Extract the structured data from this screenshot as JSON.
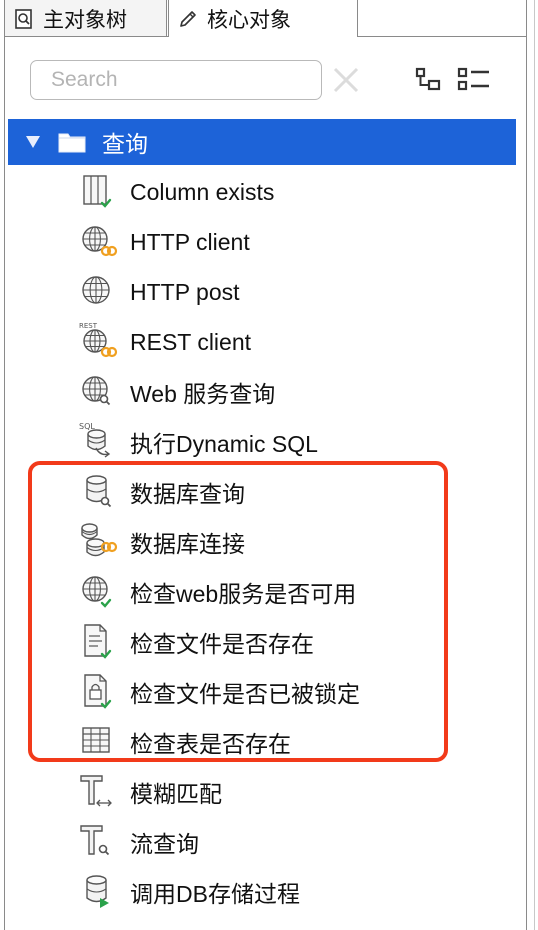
{
  "tabs": [
    {
      "label": "主对象树",
      "icon": "tree-search-icon"
    },
    {
      "label": "核心对象",
      "icon": "pencil-icon",
      "active": true
    }
  ],
  "toolbar": {
    "search_placeholder": "Search",
    "clear_icon": "clear-x-icon",
    "view_icon_1": "hierarchy-view-icon",
    "view_icon_2": "list-view-icon"
  },
  "tree": {
    "root": {
      "label": "查询",
      "icon": "folder-icon",
      "expanded": true,
      "selected": true
    },
    "items": [
      {
        "label": "Column exists",
        "icon": "column-check-icon"
      },
      {
        "label": "HTTP client",
        "icon": "globe-link-icon"
      },
      {
        "label": "HTTP post",
        "icon": "globe-icon"
      },
      {
        "label": "REST client",
        "icon": "rest-globe-link-icon"
      },
      {
        "label": "Web 服务查询",
        "icon": "globe-search-icon"
      },
      {
        "label": "执行Dynamic SQL",
        "icon": "sql-database-arrow-icon"
      },
      {
        "label": "数据库查询",
        "icon": "database-search-icon"
      },
      {
        "label": "数据库连接",
        "icon": "database-link-icon"
      },
      {
        "label": "检查web服务是否可用",
        "icon": "globe-check-icon"
      },
      {
        "label": "检查文件是否存在",
        "icon": "file-check-icon"
      },
      {
        "label": "检查文件是否已被锁定",
        "icon": "file-lock-check-icon"
      },
      {
        "label": "检查表是否存在",
        "icon": "table-icon"
      },
      {
        "label": "模糊匹配",
        "icon": "fuzzy-match-icon"
      },
      {
        "label": "流查询",
        "icon": "stream-lookup-icon"
      },
      {
        "label": "调用DB存储过程",
        "icon": "database-play-icon"
      }
    ]
  },
  "colors": {
    "selection": "#1d63d8",
    "highlight_border": "#f23a1a",
    "check_green": "#2aa24a",
    "link_orange": "#f0a020"
  }
}
